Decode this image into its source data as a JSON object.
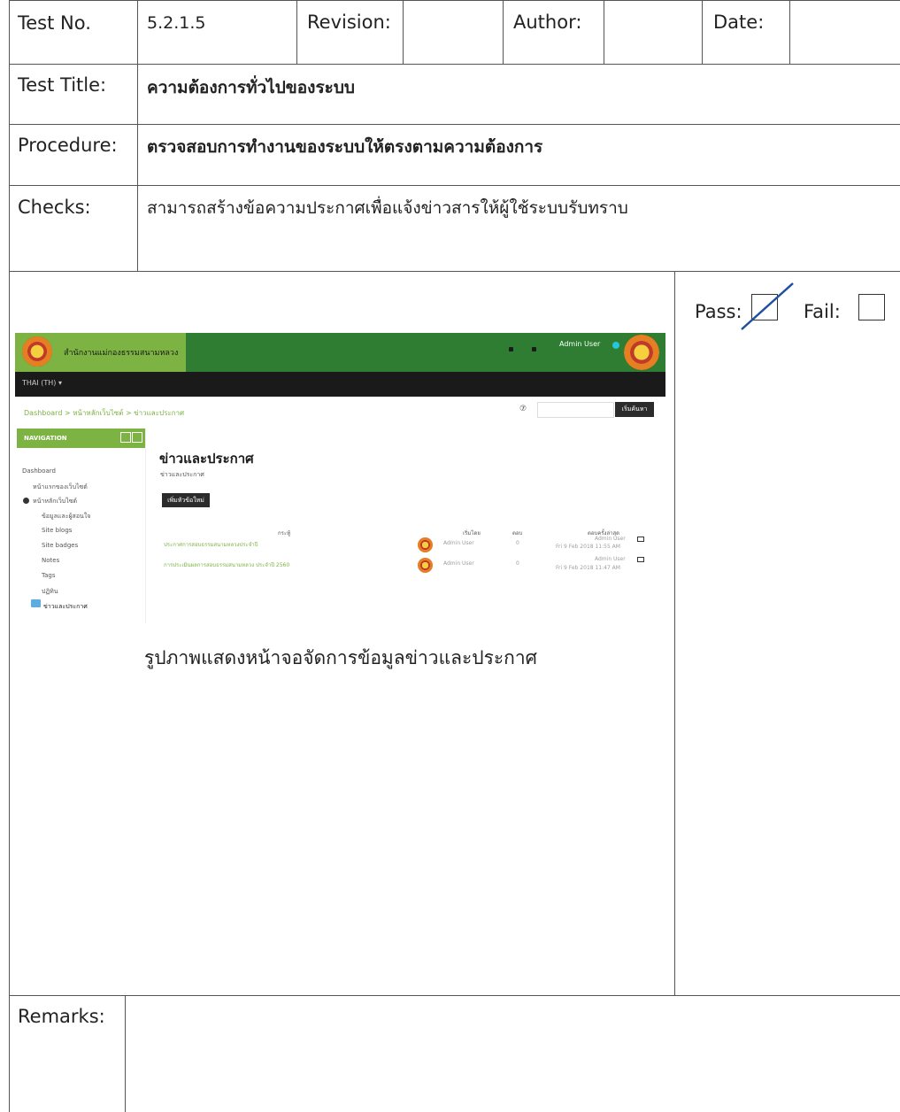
{
  "header": {
    "test_no_label": "Test No.",
    "test_no_value": "5.2.1.5",
    "revision_label": "Revision:",
    "revision_value": "",
    "author_label": "Author:",
    "author_value": "",
    "date_label": "Date:",
    "date_value": ""
  },
  "test_title": {
    "label": "Test Title:",
    "value": "ความต้องการทั่วไปของระบบ"
  },
  "procedure": {
    "label": "Procedure:",
    "value": "ตรวจสอบการทำงานของระบบให้ตรงตามความต้องการ"
  },
  "checks": {
    "label": "Checks:",
    "value": "สามารถสร้างข้อความประกาศเพื่อแจ้งข่าวสารให้ผู้ใช้ระบบรับทราบ"
  },
  "result": {
    "pass_label": "Pass:",
    "fail_label": "Fail:",
    "pass_checked": true,
    "fail_checked": false
  },
  "screenshot": {
    "site_name": "สำนักงานแม่กองธรรมสนามหลวง",
    "admin_user": "Admin User",
    "menu": "THAI (TH) ▾",
    "breadcrumb": "Dashboard  >  หน้าหลักเว็บไซต์  >  ข่าวและประกาศ",
    "help_icon": "help-icon",
    "search_button": "เริ่มค้นหา",
    "nav_header": "NAVIGATION",
    "nav_items": [
      "Dashboard",
      "หน้าแรกของเว็บไซต์",
      "หน้าหลักเว็บไซต์",
      "ข้อมูลและผู้สอนใจ",
      "Site blogs",
      "Site badges",
      "Notes",
      "Tags",
      "ปฏิทิน",
      "ข่าวและประกาศ"
    ],
    "page_title": "ข่าวและประกาศ",
    "page_subtitle": "ข่าวและประกาศ",
    "add_button": "เพิ่มหัวข้อใหม่",
    "table_headers": {
      "topic": "กระทู้",
      "started_by": "เริ่มโดย",
      "replies": "ตอบ",
      "last_post": "ตอบครั้งล่าสุด"
    },
    "rows": [
      {
        "topic": "ประกาศการสอบธรรมสนามหลวงประจำปี",
        "started_by": "Admin User",
        "replies": "0",
        "last_user": "Admin User",
        "last_date": "Fri 9 Feb 2018 11:55 AM"
      },
      {
        "topic": "การประเมินผลการสอบธรรมสนามหลวง ประจำปี 2560",
        "started_by": "Admin User",
        "replies": "0",
        "last_user": "Admin User",
        "last_date": "Fri 9 Feb 2018 11:47 AM"
      }
    ]
  },
  "caption": "รูปภาพแสดงหน้าจอจัดการข้อมูลข่าวและประกาศ",
  "remarks": {
    "label": "Remarks:",
    "value": ""
  }
}
